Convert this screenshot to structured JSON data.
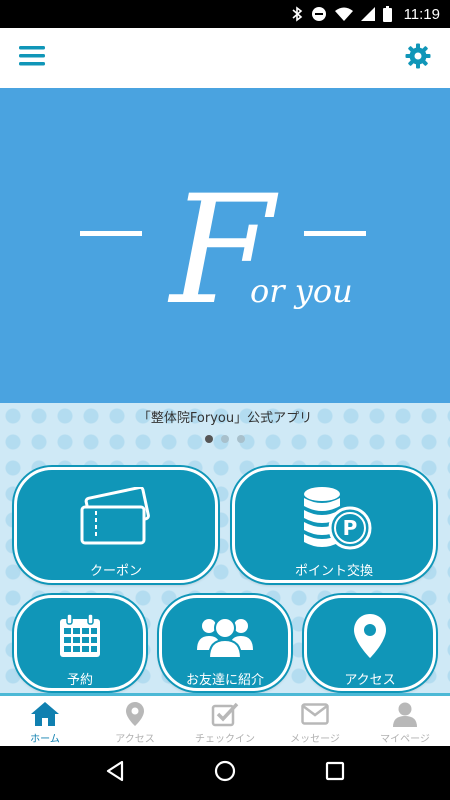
{
  "status_bar": {
    "time": "11:19"
  },
  "banner": {
    "logo_letter": "F",
    "logo_rest": "or you"
  },
  "caption": "「整体院Foryou」公式アプリ",
  "tiles": {
    "coupon": "クーポン",
    "points": "ポイント交換",
    "reserve": "予約",
    "friend": "お友達に紹介",
    "access": "アクセス"
  },
  "bottom_nav": [
    {
      "label": "ホーム",
      "icon": "home-icon",
      "active": true
    },
    {
      "label": "アクセス",
      "icon": "map-pin-icon",
      "active": false
    },
    {
      "label": "チェックイン",
      "icon": "checkbox-icon",
      "active": false
    },
    {
      "label": "メッセージ",
      "icon": "envelope-icon",
      "active": false
    },
    {
      "label": "マイページ",
      "icon": "person-icon",
      "active": false
    }
  ],
  "colors": {
    "accent": "#1096b8",
    "banner": "#4aa3e0",
    "nav_active": "#1080b0"
  }
}
